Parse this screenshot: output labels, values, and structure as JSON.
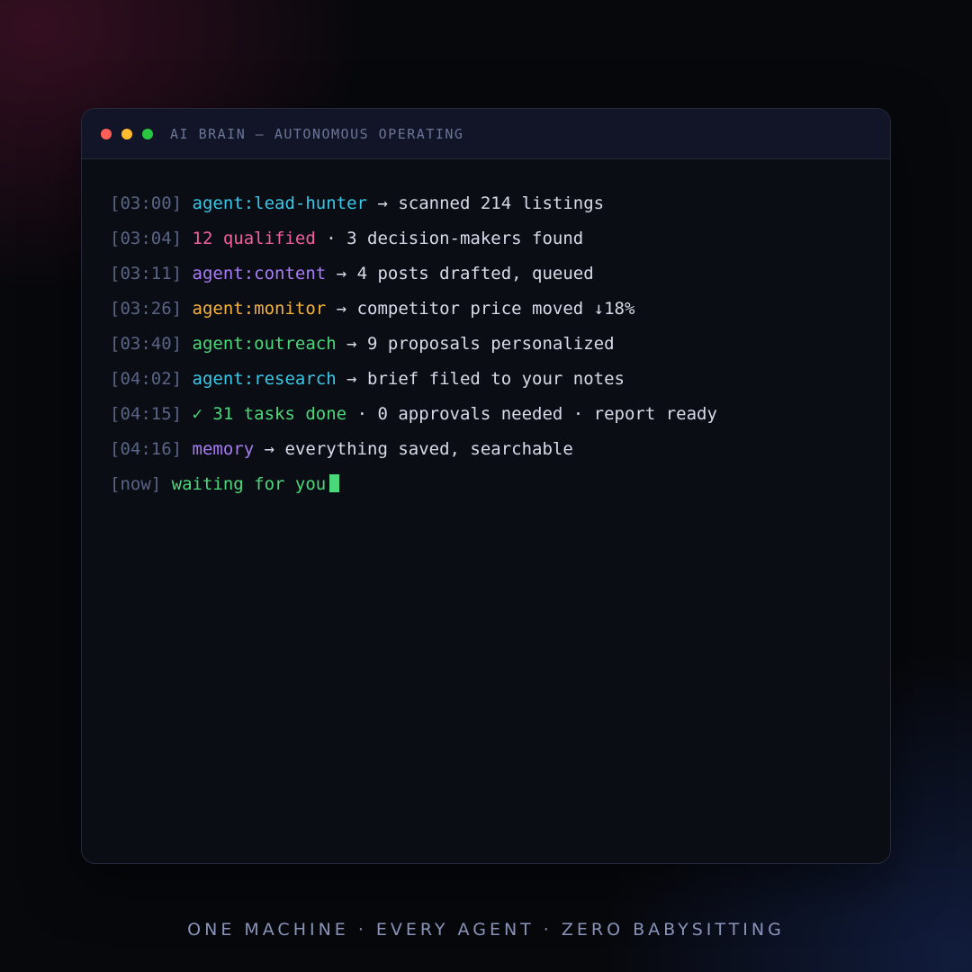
{
  "window": {
    "title": "AI BRAIN — AUTONOMOUS OPERATING"
  },
  "log": [
    {
      "time": "[03:00]",
      "source": "agent:lead-hunter",
      "sep": " → ",
      "message": "scanned 214 listings"
    },
    {
      "time": "[03:04]",
      "source": "12 qualified",
      "sep": " · ",
      "message": "3 decision-makers found"
    },
    {
      "time": "[03:11]",
      "source": "agent:content",
      "sep": " → ",
      "message": "4 posts drafted, queued"
    },
    {
      "time": "[03:26]",
      "source": "agent:monitor",
      "sep": " → ",
      "message": "competitor price moved ↓18%"
    },
    {
      "time": "[03:40]",
      "source": "agent:outreach",
      "sep": " → ",
      "message": "9 proposals personalized"
    },
    {
      "time": "[04:02]",
      "source": "agent:research",
      "sep": " → ",
      "message": "brief filed to your notes"
    },
    {
      "time": "[04:15]",
      "source": "✓ 31 tasks done",
      "sep": " · ",
      "message": "0 approvals needed · report ready"
    },
    {
      "time": "[04:16]",
      "source": "memory",
      "sep": " → ",
      "message": "everything saved, searchable"
    },
    {
      "time": "[now]",
      "source": "waiting for you",
      "sep": "",
      "message": ""
    }
  ],
  "tagline": "ONE MACHINE · EVERY AGENT · ZERO BABYSITTING",
  "colors": {
    "cyan": "#38c7e6",
    "pink": "#f0609b",
    "purple": "#a77cf5",
    "orange": "#f5b23c",
    "green": "#4bd87a",
    "timestamp": "#5a6484",
    "text": "#d7dbea"
  }
}
